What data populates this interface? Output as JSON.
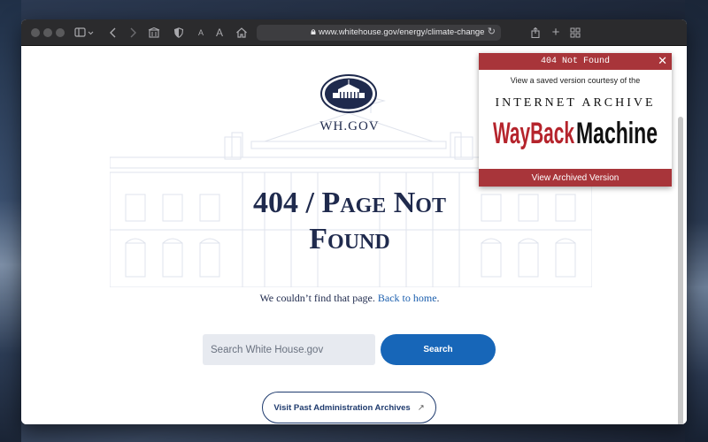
{
  "browser": {
    "url": "www.whitehouse.gov/energy/climate-change"
  },
  "page": {
    "logo_text": "WH.GOV",
    "title_line1": "404 / Page Not",
    "title_line2": "Found",
    "subtext_prefix": "We couldn’t find that page. ",
    "subtext_link": "Back to home",
    "subtext_suffix": ".",
    "search_placeholder": "Search White House.gov",
    "search_button": "Search",
    "archive_button": "Visit Past Administration Archives",
    "archive_arrow": "↗"
  },
  "wayback_popup": {
    "header": "404 Not Found",
    "close": "✕",
    "courtesy": "View a saved version courtesy of the",
    "brand_line1": "INTERNET ARCHIVE",
    "brand_logo": "WayBackMachine",
    "button": "View Archived Version",
    "accent_color": "#a8353a"
  },
  "icons": [
    "sidebar-icon",
    "back-icon",
    "forward-icon",
    "reader-icon",
    "shield-icon",
    "font-small-icon",
    "font-large-icon",
    "home-icon",
    "lock-icon",
    "reload-icon",
    "share-icon",
    "new-tab-icon",
    "tab-overview-icon"
  ]
}
